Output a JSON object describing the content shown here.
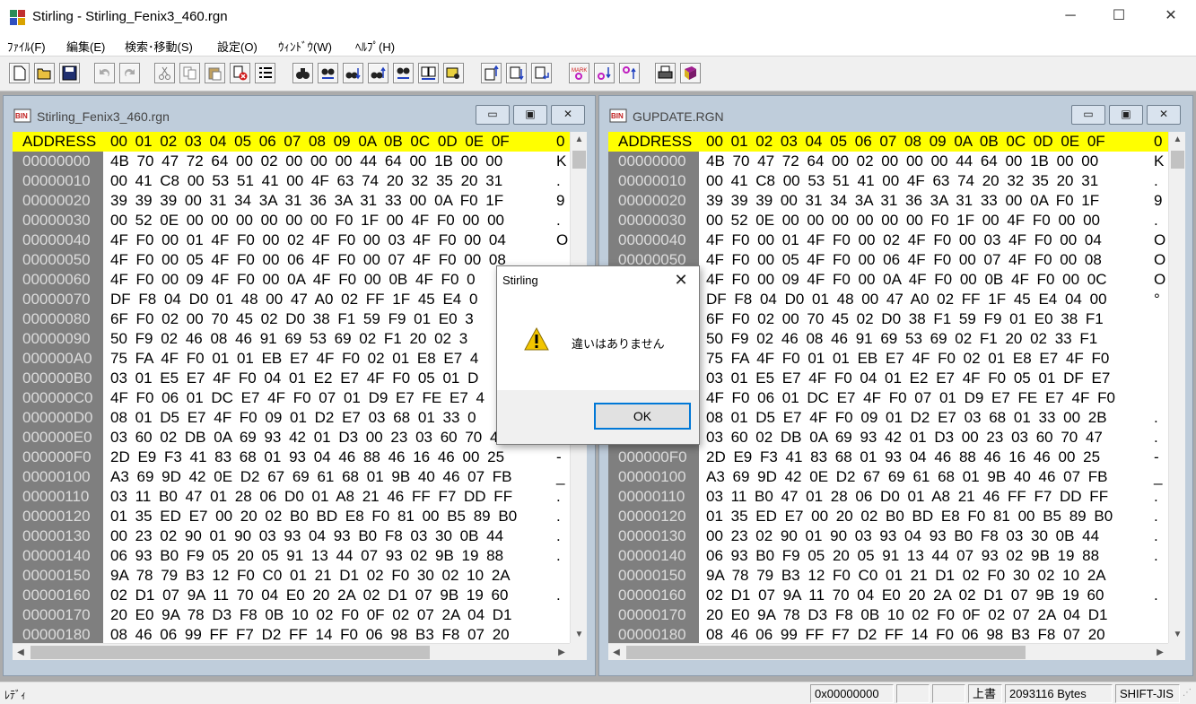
{
  "window": {
    "title": "Stirling - Stirling_Fenix3_460.rgn",
    "minimize": "─",
    "maximize": "☐",
    "close": "✕"
  },
  "menu": [
    "ﾌｧｲﾙ(F)",
    "編集(E)",
    "検索･移動(S)",
    "設定(O)",
    "ｳｨﾝﾄﾞｳ(W)",
    "ﾍﾙﾌﾟ(H)"
  ],
  "toolbar_icons": [
    "new-file-icon",
    "open-folder-icon",
    "save-icon",
    "undo-icon",
    "redo-icon",
    "cut-icon",
    "copy-icon",
    "paste-icon",
    "delete-icon",
    "list-icon",
    "find-icon",
    "find-replace-icon",
    "find-next-icon",
    "find-prev-icon",
    "find-ab-icon",
    "compare-icon",
    "print-preview-icon",
    "jump-start-icon",
    "jump-mid-icon",
    "jump-end-icon",
    "mark-icon",
    "mark-next-icon",
    "mark-prev-icon",
    "print-icon",
    "help-book-icon"
  ],
  "left_pane": {
    "title": "Stirling_Fenix3_460.rgn",
    "header": "ADDRESS",
    "columns": "00 01 02 03 04 05 06 07 08 09 0A 0B 0C 0D 0E 0F",
    "ascii_header": "0",
    "rows": [
      {
        "addr": "00000000",
        "bytes": "4B 70 47 72 64 00 02 00 00 00 44 64 00 1B 00 00",
        "ascii": "K"
      },
      {
        "addr": "00000010",
        "bytes": "00 41 C8 00 53 51 41 00 4F 63 74 20 32 35 20 31",
        "ascii": "."
      },
      {
        "addr": "00000020",
        "bytes": "39 39 39 00 31 34 3A 31 36 3A 31 33 00 0A F0 1F",
        "ascii": "9"
      },
      {
        "addr": "00000030",
        "bytes": "00 52 0E 00 00 00 00 00 00 F0 1F 00 4F F0 00 00",
        "ascii": "."
      },
      {
        "addr": "00000040",
        "bytes": "4F F0 00 01 4F F0 00 02 4F F0 00 03 4F F0 00 04",
        "ascii": "O"
      },
      {
        "addr": "00000050",
        "bytes": "4F F0 00 05 4F F0 00 06 4F F0 00 07 4F F0 00 08",
        "ascii": ""
      },
      {
        "addr": "00000060",
        "bytes": "4F F0 00 09 4F F0 00 0A 4F F0 00 0B 4F F0 0",
        "ascii": ""
      },
      {
        "addr": "00000070",
        "bytes": "DF F8 04 D0 01 48 00 47 A0 02 FF 1F 45 E4 0",
        "ascii": ""
      },
      {
        "addr": "00000080",
        "bytes": "6F F0 02 00 70 45 02 D0 38 F1 59 F9 01 E0 3",
        "ascii": ""
      },
      {
        "addr": "00000090",
        "bytes": "50 F9 02 46 08 46 91 69 53 69 02 F1 20 02 3",
        "ascii": ""
      },
      {
        "addr": "000000A0",
        "bytes": "75 FA 4F F0 01 01 EB E7 4F F0 02 01 E8 E7 4",
        "ascii": ""
      },
      {
        "addr": "000000B0",
        "bytes": "03 01 E5 E7 4F F0 04 01 E2 E7 4F F0 05 01 D",
        "ascii": ""
      },
      {
        "addr": "000000C0",
        "bytes": "4F F0 06 01 DC E7 4F F0 07 01 D9 E7 FE E7 4",
        "ascii": ""
      },
      {
        "addr": "000000D0",
        "bytes": "08 01 D5 E7 4F F0 09 01 D2 E7 03 68 01 33 0",
        "ascii": ""
      },
      {
        "addr": "000000E0",
        "bytes": "03 60 02 DB 0A 69 93 42 01 D3 00 23 03 60 70 47",
        "ascii": ""
      },
      {
        "addr": "000000F0",
        "bytes": "2D E9 F3 41 83 68 01 93 04 46 88 46 16 46 00 25",
        "ascii": "-"
      },
      {
        "addr": "00000100",
        "bytes": "A3 69 9D 42 0E D2 67 69 61 68 01 9B 40 46 07 FB",
        "ascii": "_"
      },
      {
        "addr": "00000110",
        "bytes": "03 11 B0 47 01 28 06 D0 01 A8 21 46 FF F7 DD FF",
        "ascii": "."
      },
      {
        "addr": "00000120",
        "bytes": "01 35 ED E7 00 20 02 B0 BD E8 F0 81 00 B5 89 B0",
        "ascii": "."
      },
      {
        "addr": "00000130",
        "bytes": "00 23 02 90 01 90 03 93 04 93 B0 F8 03 30 0B 44",
        "ascii": "."
      },
      {
        "addr": "00000140",
        "bytes": "06 93 B0 F9 05 20 05 91 13 44 07 93 02 9B 19 88",
        "ascii": "."
      },
      {
        "addr": "00000150",
        "bytes": "9A 78 79 B3 12 F0 C0 01 21 D1 02 F0 30 02 10 2A",
        "ascii": ""
      },
      {
        "addr": "00000160",
        "bytes": "02 D1 07 9A 11 70 04 E0 20 2A 02 D1 07 9B 19 60",
        "ascii": "."
      },
      {
        "addr": "00000170",
        "bytes": "20 E0 9A 78 D3 F8 0B 10 02 F0 0F 02 07 2A 04 D1",
        "ascii": ""
      },
      {
        "addr": "00000180",
        "bytes": "08 46 06 99 FF F7 D2 FF 14 F0 06 98 B3 F8 07 20",
        "ascii": ""
      }
    ]
  },
  "right_pane": {
    "title": "GUPDATE.RGN",
    "header": "ADDRESS",
    "columns": "00 01 02 03 04 05 06 07 08 09 0A 0B 0C 0D 0E 0F",
    "ascii_header": "0",
    "rows": [
      {
        "addr": "00000000",
        "bytes": "4B 70 47 72 64 00 02 00 00 00 44 64 00 1B 00 00",
        "ascii": "K"
      },
      {
        "addr": "00000010",
        "bytes": "00 41 C8 00 53 51 41 00 4F 63 74 20 32 35 20 31",
        "ascii": "."
      },
      {
        "addr": "00000020",
        "bytes": "39 39 39 00 31 34 3A 31 36 3A 31 33 00 0A F0 1F",
        "ascii": "9"
      },
      {
        "addr": "00000030",
        "bytes": "00 52 0E 00 00 00 00 00 00 F0 1F 00 4F F0 00 00",
        "ascii": "."
      },
      {
        "addr": "00000040",
        "bytes": "4F F0 00 01 4F F0 00 02 4F F0 00 03 4F F0 00 04",
        "ascii": "O"
      },
      {
        "addr": "00000050",
        "bytes": "4F F0 00 05 4F F0 00 06 4F F0 00 07 4F F0 00 08",
        "ascii": "O"
      },
      {
        "addr": "00000060",
        "bytes": "4F F0 00 09 4F F0 00 0A 4F F0 00 0B 4F F0 00 0C",
        "ascii": "O"
      },
      {
        "addr": "00000070",
        "bytes": "DF F8 04 D0 01 48 00 47 A0 02 FF 1F 45 E4 04 00",
        "ascii": "°"
      },
      {
        "addr": "00000080",
        "bytes": "6F F0 02 00 70 45 02 D0 38 F1 59 F9 01 E0 38 F1",
        "ascii": ""
      },
      {
        "addr": "00000090",
        "bytes": "50 F9 02 46 08 46 91 69 53 69 02 F1 20 02 33 F1",
        "ascii": ""
      },
      {
        "addr": "000000A0",
        "bytes": "75 FA 4F F0 01 01 EB E7 4F F0 02 01 E8 E7 4F F0",
        "ascii": ""
      },
      {
        "addr": "000000B0",
        "bytes": "03 01 E5 E7 4F F0 04 01 E2 E7 4F F0 05 01 DF E7",
        "ascii": ""
      },
      {
        "addr": "000000C0",
        "bytes": "4F F0 06 01 DC E7 4F F0 07 01 D9 E7 FE E7 4F F0",
        "ascii": ""
      },
      {
        "addr": "000000D0",
        "bytes": "08 01 D5 E7 4F F0 09 01 D2 E7 03 68 01 33 00 2B",
        "ascii": "."
      },
      {
        "addr": "000000E0",
        "bytes": "03 60 02 DB 0A 69 93 42 01 D3 00 23 03 60 70 47",
        "ascii": "."
      },
      {
        "addr": "000000F0",
        "bytes": "2D E9 F3 41 83 68 01 93 04 46 88 46 16 46 00 25",
        "ascii": "-"
      },
      {
        "addr": "00000100",
        "bytes": "A3 69 9D 42 0E D2 67 69 61 68 01 9B 40 46 07 FB",
        "ascii": "_"
      },
      {
        "addr": "00000110",
        "bytes": "03 11 B0 47 01 28 06 D0 01 A8 21 46 FF F7 DD FF",
        "ascii": "."
      },
      {
        "addr": "00000120",
        "bytes": "01 35 ED E7 00 20 02 B0 BD E8 F0 81 00 B5 89 B0",
        "ascii": "."
      },
      {
        "addr": "00000130",
        "bytes": "00 23 02 90 01 90 03 93 04 93 B0 F8 03 30 0B 44",
        "ascii": "."
      },
      {
        "addr": "00000140",
        "bytes": "06 93 B0 F9 05 20 05 91 13 44 07 93 02 9B 19 88",
        "ascii": "."
      },
      {
        "addr": "00000150",
        "bytes": "9A 78 79 B3 12 F0 C0 01 21 D1 02 F0 30 02 10 2A",
        "ascii": ""
      },
      {
        "addr": "00000160",
        "bytes": "02 D1 07 9A 11 70 04 E0 20 2A 02 D1 07 9B 19 60",
        "ascii": "."
      },
      {
        "addr": "00000170",
        "bytes": "20 E0 9A 78 D3 F8 0B 10 02 F0 0F 02 07 2A 04 D1",
        "ascii": ""
      },
      {
        "addr": "00000180",
        "bytes": "08 46 06 99 FF F7 D2 FF 14 F0 06 98 B3 F8 07 20",
        "ascii": ""
      }
    ]
  },
  "dialog": {
    "title": "Stirling",
    "message": "違いはありません",
    "ok": "OK",
    "close": "✕"
  },
  "status": {
    "text": "ﾚﾃﾞｨ",
    "offset": "0x00000000",
    "mode": "上書",
    "size": "2093116 Bytes",
    "encoding": "SHIFT-JIS"
  },
  "colors": {
    "header_bg": "#ffff00",
    "address_bg": "#7f7f7f",
    "mdi_bg": "#ababab",
    "child_frame": "#bfcddb",
    "ok_focus": "#0078d7"
  }
}
